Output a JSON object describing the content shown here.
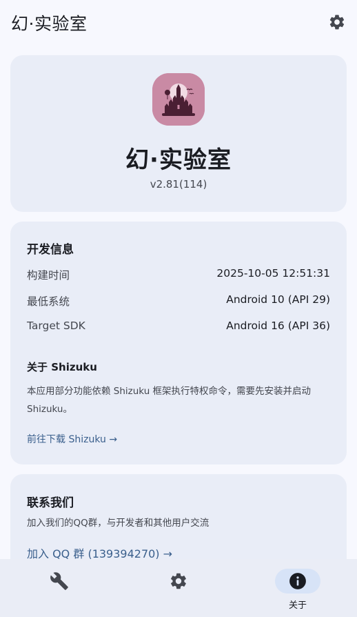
{
  "app_bar": {
    "title": "幻·实验室",
    "settings_icon": "gear-icon"
  },
  "hero": {
    "app_name": "幻·实验室",
    "version": "v2.81(114)",
    "logo_icon": "castle-logo-icon"
  },
  "dev_info": {
    "title": "开发信息",
    "rows": [
      {
        "label": "构建时间",
        "value": "2025-10-05 12:51:31"
      },
      {
        "label": "最低系统",
        "value": "Android 10 (API 29)"
      },
      {
        "label": "Target SDK",
        "value": "Android 16 (API 36)"
      }
    ],
    "shizuku": {
      "title": "关于 Shizuku",
      "description": "本应用部分功能依赖 Shizuku 框架执行特权命令，需要先安装并启动 Shizuku。",
      "link": "前往下载 Shizuku →"
    }
  },
  "contact": {
    "title": "联系我们",
    "description": "加入我们的QQ群，与开发者和其他用户交流",
    "link": "加入 QQ 群 (139394270) →"
  },
  "bottom_nav": {
    "items": [
      {
        "icon": "wrench-icon",
        "label": "",
        "active": false
      },
      {
        "icon": "gear-icon",
        "label": "",
        "active": false
      },
      {
        "icon": "info-icon",
        "label": "关于",
        "active": true
      }
    ]
  },
  "colors": {
    "background": "#f7f8fe",
    "card": "#e9edf7",
    "link": "#3a5f8c",
    "nav_active": "#d7e3f7",
    "logo": "#c98aa4"
  }
}
